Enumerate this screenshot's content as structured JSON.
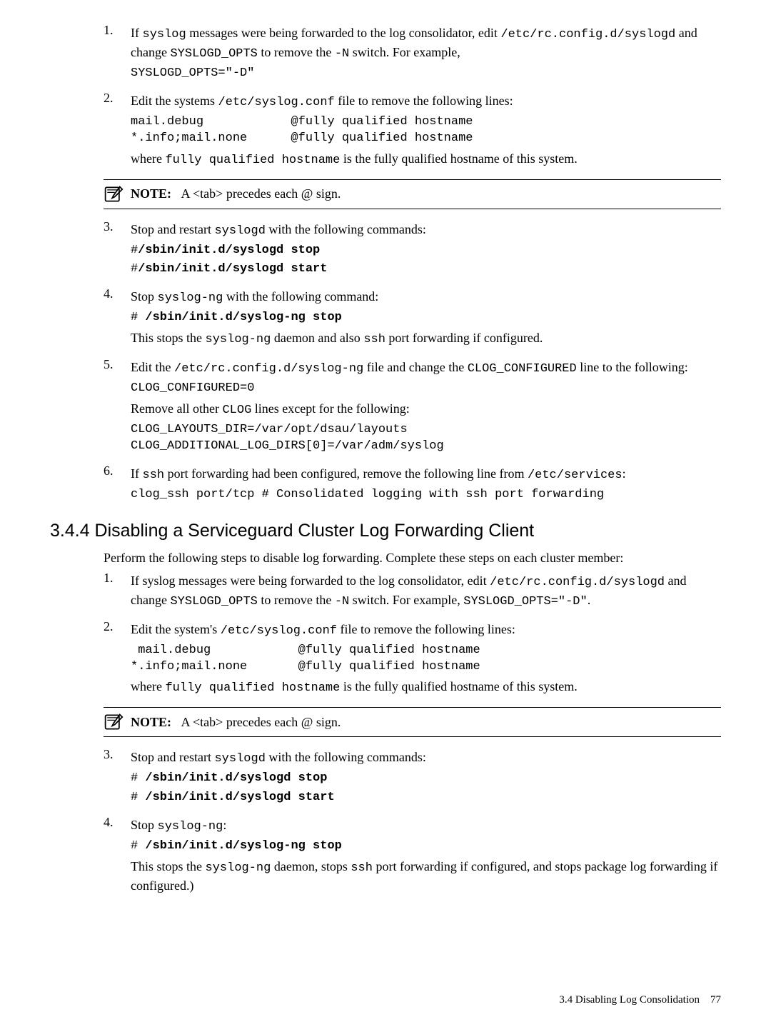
{
  "s1": {
    "i1": {
      "n": "1.",
      "a": "If ",
      "b": "syslog",
      "c": " messages were being forwarded to the log consolidator, edit ",
      "d": "/etc/rc.config.d/syslogd",
      "e": " and change ",
      "f": "SYSLOGD_OPTS",
      "g": " to remove the ",
      "h": "-N",
      "i": " switch. For example,",
      "code": "SYSLOGD_OPTS=\"-D\""
    },
    "i2": {
      "n": "2.",
      "a": "Edit the systems ",
      "b": "/etc/syslog.conf",
      "c": " file to remove the following lines:",
      "code": "mail.debug            @fully qualified hostname\n*.info;mail.none      @fully qualified hostname",
      "d": "where ",
      "e": "fully qualified hostname",
      "f": " is the fully qualified hostname of this system."
    },
    "note1": {
      "label": "NOTE:",
      "text": "A <tab> precedes each @ sign."
    },
    "i3": {
      "n": "3.",
      "a": "Stop and restart ",
      "b": "syslogd",
      "c": " with the following commands:",
      "l1p": "#",
      "l1b": "/sbin/init.d/syslogd stop",
      "l2p": "#",
      "l2b": "/sbin/init.d/syslogd start"
    },
    "i4": {
      "n": "4.",
      "a": "Stop ",
      "b": "syslog-ng",
      "c": " with the following command:",
      "l1p": "# ",
      "l1b": "/sbin/init.d/syslog-ng stop",
      "d": "This stops the ",
      "e": "syslog-ng",
      "f": " daemon and also ",
      "g": "ssh",
      "h": " port forwarding if configured."
    },
    "i5": {
      "n": "5.",
      "a": "Edit the ",
      "b": "/etc/rc.config.d/syslog-ng",
      "c": " file and change the ",
      "d": "CLOG_CONFIGURED",
      "e": " line to the following:",
      "code1": "CLOG_CONFIGURED=0",
      "f": "Remove all other ",
      "g": "CLOG",
      "h": " lines except for the following:",
      "code2": "CLOG_LAYOUTS_DIR=/var/opt/dsau/layouts\nCLOG_ADDITIONAL_LOG_DIRS[0]=/var/adm/syslog"
    },
    "i6": {
      "n": "6.",
      "a": "If ",
      "b": "ssh",
      "c": " port forwarding had been configured, remove the following line from ",
      "d": "/etc/services",
      "e": ":",
      "code": "clog_ssh port/tcp # Consolidated logging with ssh port forwarding"
    }
  },
  "heading": "3.4.4 Disabling a Serviceguard Cluster Log Forwarding Client",
  "s2": {
    "intro": "Perform the following steps to disable  log forwarding. Complete these steps on each cluster member:",
    "i1": {
      "n": "1.",
      "a": "If syslog messages were being forwarded to the log consolidator, edit ",
      "b": "/etc/rc.config.d/syslogd",
      "c": " and change ",
      "d": "SYSLOGD_OPTS",
      "e": " to remove the ",
      "f": "-N",
      "g": " switch. For example, ",
      "h": "SYSLOGD_OPTS=\"-D\"",
      "i": "."
    },
    "i2": {
      "n": "2.",
      "a": "Edit the system's ",
      "b": "/etc/syslog.conf",
      "c": " file to remove the following lines:",
      "code": " mail.debug            @fully qualified hostname\n*.info;mail.none       @fully qualified hostname",
      "d": "where ",
      "e": "fully qualified hostname",
      "f": " is the fully qualified hostname of this system."
    },
    "note1": {
      "label": "NOTE:",
      "text": "A <tab> precedes each @ sign."
    },
    "i3": {
      "n": "3.",
      "a": "Stop and restart ",
      "b": "syslogd",
      "c": " with the following commands:",
      "l1p": "# ",
      "l1b": "/sbin/init.d/syslogd stop",
      "l2p": "# ",
      "l2b": "/sbin/init.d/syslogd start"
    },
    "i4": {
      "n": "4.",
      "a": "Stop ",
      "b": "syslog-ng",
      "c": ":",
      "l1p": "# ",
      "l1b": "/sbin/init.d/syslog-ng stop",
      "d": "This stops the ",
      "e": "syslog-ng",
      "f": " daemon, stops ",
      "g": "ssh",
      "h": " port forwarding if configured, and stops package log forwarding if configured.)"
    }
  },
  "footer": {
    "section": "3.4 Disabling Log Consolidation",
    "page": "77"
  }
}
